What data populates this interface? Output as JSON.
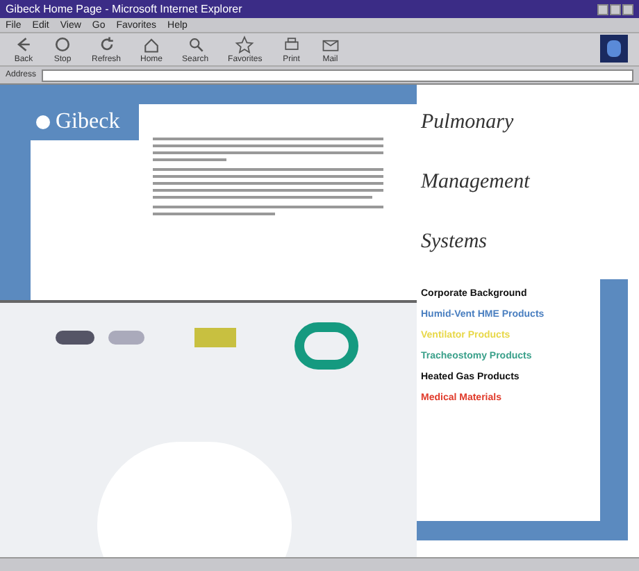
{
  "window": {
    "title": "Gibeck Home Page - Microsoft Internet Explorer"
  },
  "menu": [
    "File",
    "Edit",
    "View",
    "Go",
    "Favorites",
    "Help"
  ],
  "toolbar": [
    "Back",
    "Stop",
    "Refresh",
    "Home",
    "Search",
    "Favorites",
    "Print",
    "Mail"
  ],
  "address": {
    "label": "Address"
  },
  "page": {
    "logo": "Gibeck",
    "headings": [
      "Pulmonary",
      "Management",
      "Systems"
    ],
    "links": [
      {
        "label": "Corporate Background",
        "color": "#111111"
      },
      {
        "label": "Humid-Vent HME Products",
        "color": "#4a7fc0"
      },
      {
        "label": "Ventilator Products",
        "color": "#e8d84a"
      },
      {
        "label": "Tracheostomy Products",
        "color": "#3aa08a"
      },
      {
        "label": "Heated Gas Products",
        "color": "#111111"
      },
      {
        "label": "Medical Materials",
        "color": "#e03a2a"
      }
    ]
  }
}
